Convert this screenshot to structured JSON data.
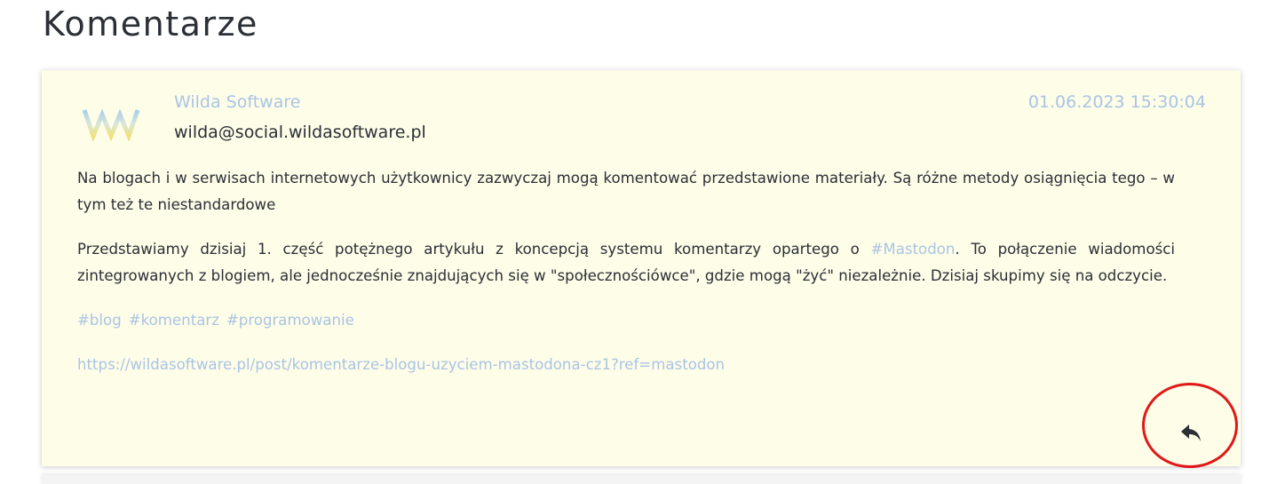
{
  "page": {
    "title": "Komentarze"
  },
  "comment": {
    "author_name": "Wilda Software",
    "author_handle": "wilda@social.wildasoftware.pl",
    "date": "01.06.2023 15:30:04",
    "avatar_icon": "wilda-logo-icon",
    "paragraph1": "Na blogach i w serwisach internetowych użytkownicy zazwyczaj mogą komentować przedstawione materiały. Są różne metody osiągnięcia tego – w tym też te niestandardowe",
    "paragraph2_before": "Przedstawiamy dzisiaj 1. część potężnego artykułu z koncepcją systemu komentarzy opartego o ",
    "paragraph2_link": "#Mastodon",
    "paragraph2_after": ". To połączenie wiadomości zintegrowanych z blogiem, ale jednocześnie znajdujących się w \"społecznościówce\", gdzie mogą \"żyć\" niezależnie. Dzisiaj skupimy się na odczycie.",
    "hashtags": [
      "#blog",
      "#komentarz",
      "#programowanie"
    ],
    "url": "https://wildasoftware.pl/post/komentarze-blogu-uzyciem-mastodona-cz1?ref=mastodon",
    "reply_icon": "reply-icon"
  },
  "colors": {
    "card_background": "#fefde8",
    "link": "#a9c4e4",
    "text": "#2b2f36",
    "annotation": "#e01818"
  }
}
